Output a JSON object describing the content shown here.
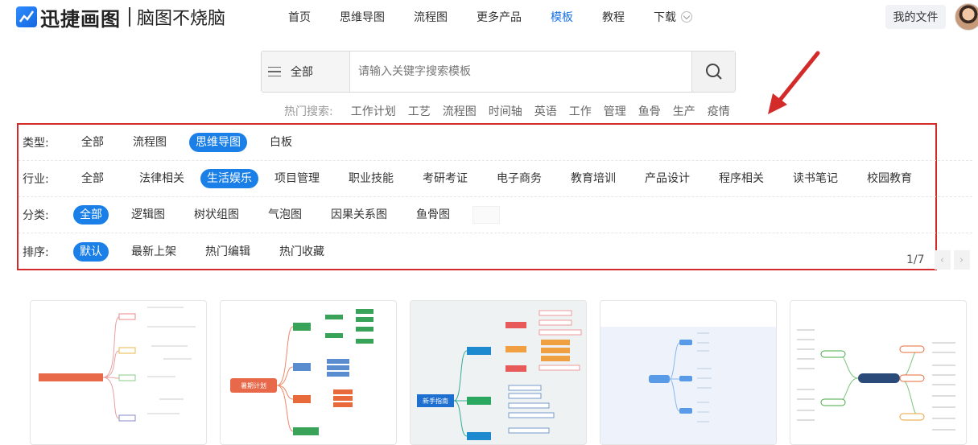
{
  "header": {
    "brand": "迅捷画图",
    "slogan": "脑图不烧脑",
    "nav": [
      {
        "label": "首页"
      },
      {
        "label": "思维导图"
      },
      {
        "label": "流程图"
      },
      {
        "label": "更多产品"
      },
      {
        "label": "模板"
      },
      {
        "label": "教程"
      },
      {
        "label": "下载"
      }
    ],
    "active_nav": "模板",
    "my_files": "我的文件"
  },
  "search": {
    "category": "全部",
    "placeholder": "请输入关键字搜索模板"
  },
  "hot_search": {
    "label": "热门搜索:",
    "tags": [
      "工作计划",
      "工艺",
      "流程图",
      "时间轴",
      "英语",
      "工作",
      "管理",
      "鱼骨",
      "生产",
      "疫情"
    ]
  },
  "filters": {
    "type": {
      "label": "类型:",
      "options": [
        "全部",
        "流程图",
        "思维导图",
        "白板"
      ],
      "selected": "思维导图"
    },
    "industry": {
      "label": "行业:",
      "options": [
        "全部",
        "法律相关",
        "生活娱乐",
        "项目管理",
        "职业技能",
        "考研考证",
        "电子商务",
        "教育培训",
        "产品设计",
        "程序相关",
        "读书笔记",
        "校园教育"
      ],
      "selected": "生活娱乐"
    },
    "category": {
      "label": "分类:",
      "options": [
        "全部",
        "逻辑图",
        "树状组图",
        "气泡图",
        "因果关系图",
        "鱼骨图"
      ],
      "selected": "全部"
    },
    "sort": {
      "label": "排序:",
      "options": [
        "默认",
        "最新上架",
        "热门编辑",
        "热门收藏"
      ],
      "selected": "默认"
    }
  },
  "pagination": {
    "label": "1/7"
  },
  "cards": [
    {
      "title": "",
      "center": ""
    },
    {
      "title": "",
      "center": "暑期计划"
    },
    {
      "title": "",
      "center": "新手指南"
    },
    {
      "title": "",
      "center": ""
    },
    {
      "title": "",
      "center": ""
    }
  ],
  "colors": {
    "accent": "#1a7fe6",
    "highlight_border": "#d32a2a"
  }
}
